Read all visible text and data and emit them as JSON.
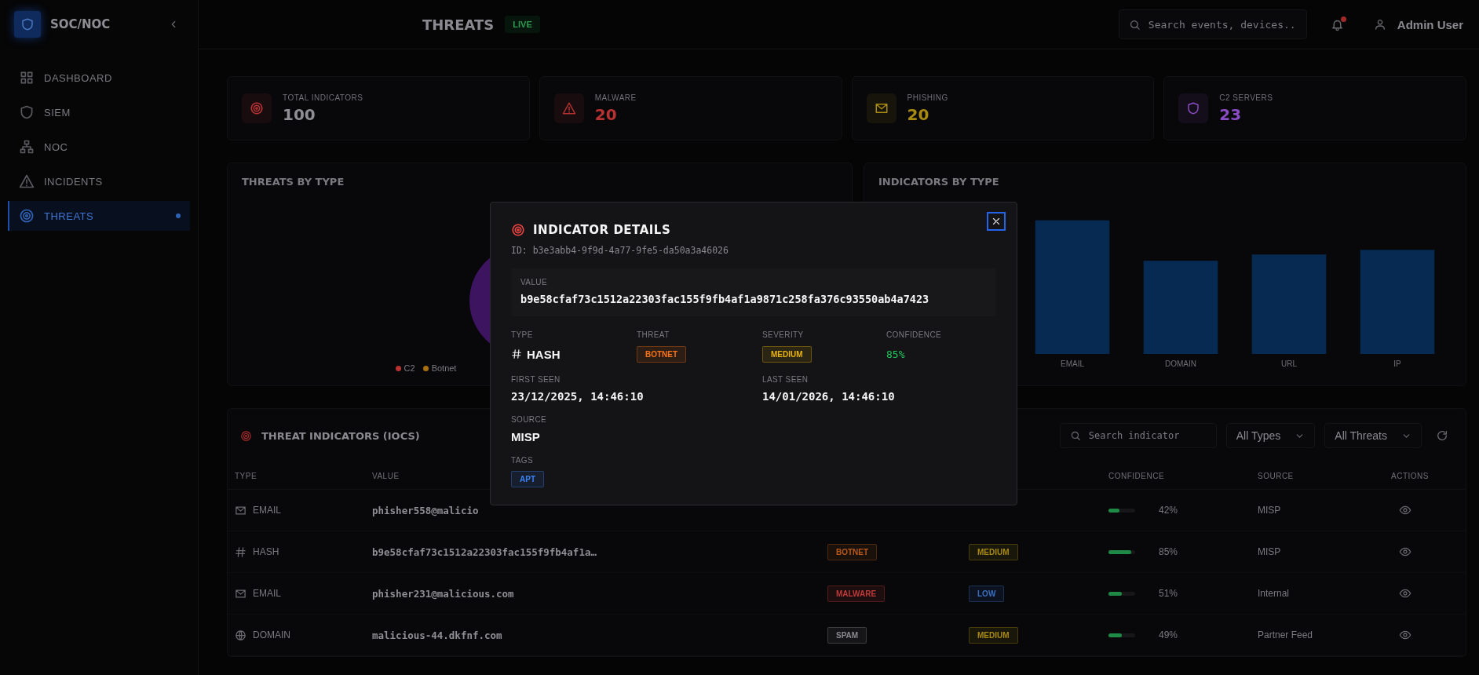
{
  "sidebar": {
    "brand": "SOC/NOC",
    "items": [
      {
        "label": "DASHBOARD",
        "kind": "grid",
        "selected": false
      },
      {
        "label": "SIEM",
        "kind": "shield",
        "selected": false
      },
      {
        "label": "NOC",
        "kind": "network",
        "selected": false
      },
      {
        "label": "INCIDENTS",
        "kind": "warning",
        "selected": false
      },
      {
        "label": "THREATS",
        "kind": "target",
        "selected": true
      }
    ]
  },
  "header": {
    "title": "THREATS",
    "live_badge": "LIVE",
    "search": {
      "placeholder": "Search events, devices.."
    },
    "notifications": {
      "unread": true
    },
    "user": "Admin User"
  },
  "stats": [
    {
      "label": "TOTAL INDICATORS",
      "value": "100",
      "kind": "target",
      "color": "#b83232"
    },
    {
      "label": "MALWARE",
      "value": "20",
      "kind": "warning",
      "color": "#b83232"
    },
    {
      "label": "PHISHING",
      "value": "20",
      "kind": "mail",
      "color": "#a88a10"
    },
    {
      "label": "C2 SERVERS",
      "value": "23",
      "kind": "shield",
      "color": "#8a4cc4"
    }
  ],
  "threats_chart": {
    "title": "THREATS BY TYPE",
    "legend": [
      {
        "label": "C2",
        "color": "#b83232"
      },
      {
        "label": "Botnet",
        "color": "#a8700e"
      }
    ]
  },
  "indicators_chart": {
    "title": "INDICATORS BY TYPE",
    "x_labels": [
      "EMAIL",
      "DOMAIN",
      "URL",
      "IP"
    ]
  },
  "table": {
    "title": "THREAT INDICATORS (IOCS)",
    "search": {
      "placeholder": "Search indicator"
    },
    "filters": [
      "All Types",
      "All Threats"
    ],
    "columns": [
      {
        "label": "TYPE"
      },
      {
        "label": "VALUE"
      },
      {
        "label": "CONFIDENCE"
      },
      {
        "label": "SOURCE"
      },
      {
        "label": "ACTIONS"
      }
    ],
    "rows": [
      {
        "kind": "email",
        "type": "EMAIL",
        "value": "phisher558@malicio",
        "confidence": {
          "level": 0.42,
          "reading": "42%"
        },
        "source": "MISP"
      },
      {
        "kind": "hash",
        "type": "HASH",
        "value": "b9e58cfaf73c1512a22303fac155f9fb4af1a…",
        "threat": {
          "label": "BOTNET",
          "color": "#b85a1c"
        },
        "severity": {
          "label": "MEDIUM",
          "color": "#a88a10"
        },
        "confidence": {
          "level": 0.85,
          "reading": "85%"
        },
        "source": "MISP"
      },
      {
        "kind": "email",
        "type": "EMAIL",
        "value": "phisher231@malicious.com",
        "threat": {
          "label": "MALWARE",
          "color": "#c03a3a"
        },
        "severity": {
          "label": "LOW",
          "color": "#3a6fc4"
        },
        "confidence": {
          "level": 0.51,
          "reading": "51%"
        },
        "source": "Internal"
      },
      {
        "kind": "domain",
        "type": "DOMAIN",
        "value": "malicious-44.dkfnf.com",
        "threat": {
          "label": "SPAM",
          "color": "#8a8a90"
        },
        "severity": {
          "label": "MEDIUM",
          "color": "#a88a10"
        },
        "confidence": {
          "level": 0.49,
          "reading": "49%"
        },
        "source": "Partner Feed"
      }
    ]
  },
  "modal": {
    "title": "INDICATOR DETAILS",
    "id": "ID: b3e3abb4-9f9d-4a77-9fe5-da50a3a46026",
    "value_label": "VALUE",
    "value": "b9e58cfaf73c1512a22303fac155f9fb4af1a9871c258fa376c93550ab4a7423",
    "fields": [
      {
        "label": "TYPE",
        "kind": "type",
        "value": "HASH"
      },
      {
        "label": "THREAT",
        "kind": "badge",
        "value": "BOTNET",
        "color": "#f97316"
      },
      {
        "label": "SEVERITY",
        "kind": "badge",
        "value": "MEDIUM",
        "color": "#eab308"
      },
      {
        "label": "CONFIDENCE",
        "kind": "percent",
        "value": "85%"
      }
    ],
    "dates": [
      {
        "label": "FIRST SEEN",
        "value": "23/12/2025, 14:46:10"
      },
      {
        "label": "LAST SEEN",
        "value": "14/01/2026, 14:46:10"
      }
    ],
    "source": {
      "label": "SOURCE",
      "value": "MISP"
    },
    "tags": {
      "label": "TAGS",
      "items": [
        {
          "label": "APT",
          "color": "#3b82f6"
        }
      ]
    }
  }
}
